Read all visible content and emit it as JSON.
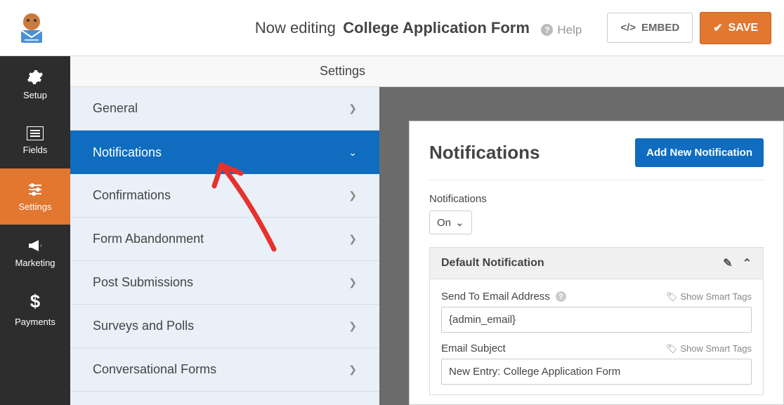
{
  "topbar": {
    "now_editing": "Now editing",
    "form_title": "College Application Form",
    "help_label": "Help",
    "embed_label": "EMBED",
    "save_label": "SAVE"
  },
  "sidebar": {
    "items": [
      {
        "label": "Setup",
        "icon": "⚙"
      },
      {
        "label": "Fields",
        "icon": "≣"
      },
      {
        "label": "Settings",
        "icon": "⚙",
        "active": true
      },
      {
        "label": "Marketing",
        "icon": "📣"
      },
      {
        "label": "Payments",
        "icon": "$"
      }
    ]
  },
  "settings_column": {
    "header": "Settings",
    "items": [
      {
        "label": "General"
      },
      {
        "label": "Notifications",
        "active": true
      },
      {
        "label": "Confirmations"
      },
      {
        "label": "Form Abandonment"
      },
      {
        "label": "Post Submissions"
      },
      {
        "label": "Surveys and Polls"
      },
      {
        "label": "Conversational Forms"
      }
    ]
  },
  "panel": {
    "title": "Notifications",
    "add_button": "Add New Notification",
    "toggle_label": "Notifications",
    "toggle_value": "On",
    "box": {
      "title": "Default Notification",
      "fields": [
        {
          "label": "Send To Email Address",
          "value": "{admin_email}",
          "smart_tags": "Show Smart Tags",
          "has_help": true
        },
        {
          "label": "Email Subject",
          "value": "New Entry: College Application Form",
          "smart_tags": "Show Smart Tags",
          "has_help": false
        }
      ]
    }
  },
  "colors": {
    "accent_orange": "#e27730",
    "accent_blue": "#0f6cbf"
  }
}
